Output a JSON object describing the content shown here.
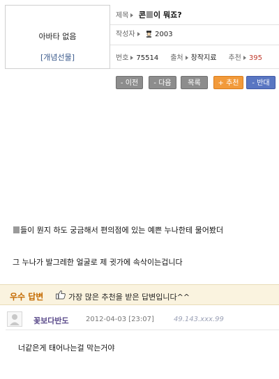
{
  "avatar": {
    "no_avatar_text": "아바타 없음",
    "tag_text": "[개념선물]"
  },
  "post": {
    "title_label": "제목",
    "title_value_start": "콘",
    "title_value_end": "이 뭐죠?",
    "writer_label": "작성자",
    "writer_value": "2003",
    "number_label": "번호",
    "number_value": "75514",
    "source_label": "출처",
    "source_value": "창작지료",
    "recommend_label": "추천",
    "recommend_value": "395"
  },
  "buttons": {
    "prev": "- 이전",
    "next": "- 다음",
    "list": "목록",
    "recommend": "+ 추천",
    "oppose": "- 반대"
  },
  "content": {
    "line1_end": "들이 뭔지 하도 궁금해서 편의점에 있는 예쁜 누나한테 물어봤더",
    "line2": "그 누나가 발그레한 얼굴로 제 귓가에 속삭이는겁니다"
  },
  "best_answer": {
    "label": "우수 답변",
    "message": "가장 많은 추천을 받은 답변입니다^^"
  },
  "reply": {
    "author": "꽃보다반도",
    "date": "2012-04-03 [23:07]",
    "ip": "49.143.xxx.99",
    "body": "너같은게 태어나는걸 막는거야"
  },
  "colors": {
    "recommend_button": "#f29a3a",
    "oppose_button": "#5976c2",
    "gray_button": "#8d8d8d",
    "best_answer_text": "#c46a00",
    "best_answer_bar": "#faf3df",
    "recommend_count": "#c0392b"
  }
}
